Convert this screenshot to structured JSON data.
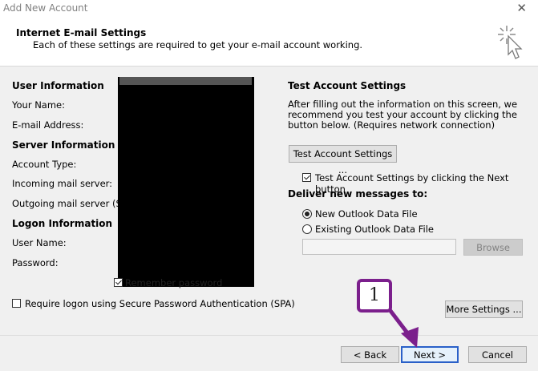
{
  "window": {
    "title": "Add New Account"
  },
  "header": {
    "title": "Internet E-mail Settings",
    "subtitle": "Each of these settings are required to get your e-mail account working."
  },
  "left": {
    "user_info_heading": "User Information",
    "your_name_label": "Your Name:",
    "email_label": "E-mail Address:",
    "server_info_heading": "Server Information",
    "account_type_label": "Account Type:",
    "incoming_label": "Incoming mail server:",
    "outgoing_label": "Outgoing mail server (SMTP",
    "logon_heading": "Logon Information",
    "user_name_label": "User Name:",
    "password_label": "Password:",
    "remember_password_label": "Remember password",
    "spa_label": "Require logon using Secure Password Authentication (SPA)"
  },
  "right": {
    "test_heading": "Test Account Settings",
    "test_desc": "After filling out the information on this screen, we recommend you test your account by clicking the button below. (Requires network connection)",
    "test_button": "Test Account Settings ...",
    "test_on_next_label": "Test Account Settings by clicking the Next button",
    "deliver_heading": "Deliver new messages to:",
    "new_data_file_label": "New Outlook Data File",
    "existing_data_file_label": "Existing Outlook Data File",
    "browse_button": "Browse",
    "more_settings_button": "More Settings ..."
  },
  "footer": {
    "back_button": "< Back",
    "next_button": "Next >",
    "cancel_button": "Cancel"
  },
  "annotation": {
    "step_number": "1",
    "color": "#7b1f8c"
  },
  "state": {
    "remember_password_checked": true,
    "spa_checked": false,
    "test_on_next_checked": true,
    "deliver_choice": "new"
  }
}
